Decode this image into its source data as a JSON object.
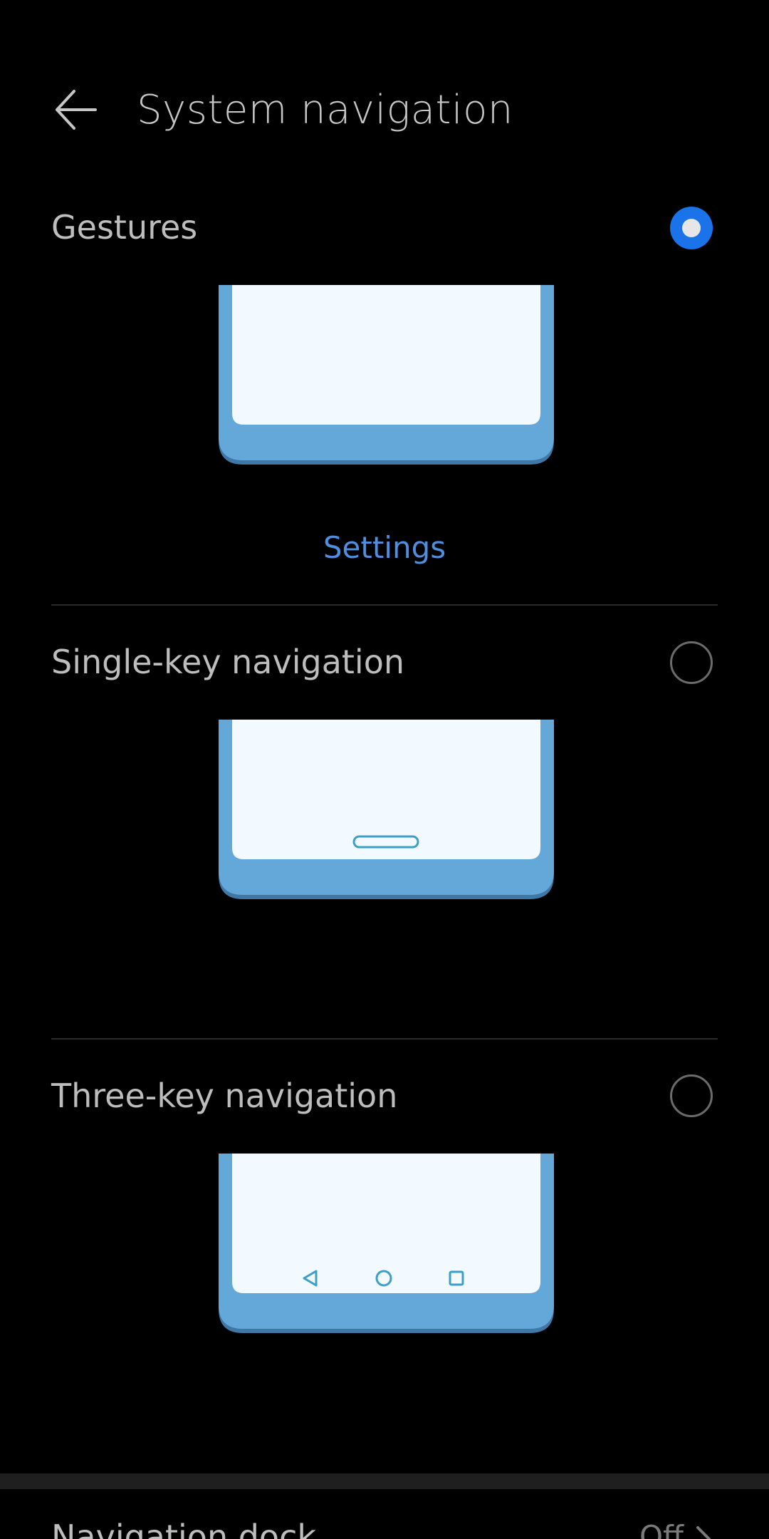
{
  "header": {
    "title": "System navigation",
    "back_icon": "arrow-left-icon"
  },
  "options": [
    {
      "label": "Gestures",
      "selected": true,
      "illustration": "gestures-phone-illustration"
    },
    {
      "label": "Single-key navigation",
      "selected": false,
      "illustration": "single-key-phone-illustration"
    },
    {
      "label": "Three-key navigation",
      "selected": false,
      "illustration": "three-key-phone-illustration"
    }
  ],
  "gestures_settings_link": "Settings",
  "navigation_dock": {
    "label": "Navigation dock",
    "value": "Off",
    "chevron_icon": "chevron-right-icon"
  },
  "colors": {
    "background": "#000000",
    "accent": "#1a73e8",
    "link": "#4f8fe0",
    "phone_frame": "#64a8da",
    "phone_screen": "#f2f9ff"
  }
}
